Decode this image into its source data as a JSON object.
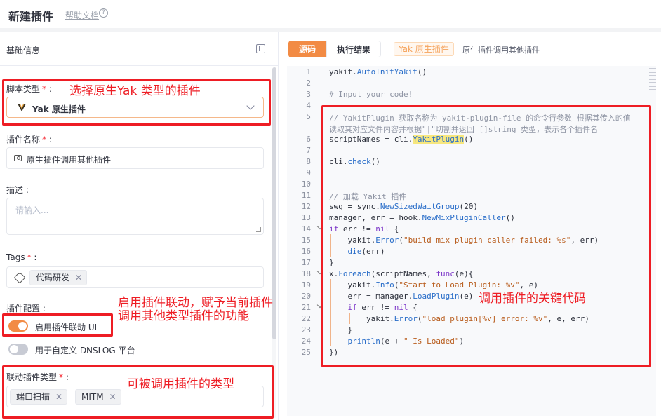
{
  "header": {
    "title": "新建插件",
    "help_link": "帮助文档",
    "help_icon": "question-circle-icon"
  },
  "left_panel": {
    "title": "基础信息",
    "script_type": {
      "label": "脚本类型",
      "required_mark": "*",
      "colon": ":",
      "value": "Yak 原生插件"
    },
    "plugin_name": {
      "label": "插件名称",
      "required_mark": "*",
      "colon": ":",
      "value": "原生插件调用其他插件"
    },
    "description": {
      "label": "描述",
      "colon": ":",
      "placeholder": "请输入..."
    },
    "tags": {
      "label": "Tags",
      "required_mark": "*",
      "colon": ":",
      "items": [
        "代码研发"
      ]
    },
    "plugin_config": {
      "label": "插件配置",
      "colon": ":",
      "switches": [
        {
          "label": "启用插件联动 UI",
          "on": true
        },
        {
          "label": "用于自定义 DNSLOG 平台",
          "on": false
        }
      ]
    },
    "linked_types": {
      "label": "联动插件类型",
      "required_mark": "*",
      "colon": ":",
      "items": [
        "端口扫描",
        "MITM"
      ]
    }
  },
  "right_panel": {
    "tabs": [
      {
        "label": "源码",
        "active": true
      },
      {
        "label": "执行结果",
        "active": false
      }
    ],
    "type_badge": "Yak 原生插件",
    "plugin_name": "原生插件调用其他插件"
  },
  "code_lines": [
    {
      "n": "1",
      "t": "yakit.AutoInitYakit()"
    },
    {
      "n": "2",
      "t": ""
    },
    {
      "n": "3",
      "t": "# Input your code!"
    },
    {
      "n": "4",
      "t": ""
    },
    {
      "n": "5",
      "t": "// YakitPlugin 获取名称为 yakit-plugin-file 的命令行参数 根据其传入的值"
    },
    {
      "n": "",
      "t": "读取其对应文件内容并根据\"|\"切割并返回 []string 类型，表示各个插件名"
    },
    {
      "n": "6",
      "t": "scriptNames = cli.YakitPlugin()"
    },
    {
      "n": "7",
      "t": ""
    },
    {
      "n": "8",
      "t": "cli.check()"
    },
    {
      "n": "9",
      "t": ""
    },
    {
      "n": "10",
      "t": ""
    },
    {
      "n": "11",
      "t": "// 加载 Yakit 插件"
    },
    {
      "n": "12",
      "t": "swg = sync.NewSizedWaitGroup(20)"
    },
    {
      "n": "13",
      "t": "manager, err = hook.NewMixPluginCaller()"
    },
    {
      "n": "14",
      "t": "if err != nil {"
    },
    {
      "n": "15",
      "t": "    yakit.Error(\"build mix plugin caller failed: %s\", err)"
    },
    {
      "n": "16",
      "t": "    die(err)"
    },
    {
      "n": "17",
      "t": "}"
    },
    {
      "n": "18",
      "t": "x.Foreach(scriptNames, func(e){"
    },
    {
      "n": "19",
      "t": "    yakit.Info(\"Start to Load Plugin: %v\", e)"
    },
    {
      "n": "20",
      "t": "    err = manager.LoadPlugin(e)"
    },
    {
      "n": "21",
      "t": "    if err != nil {"
    },
    {
      "n": "22",
      "t": "        yakit.Error(\"load plugin[%v] error: %v\", e, err)"
    },
    {
      "n": "23",
      "t": "    }"
    },
    {
      "n": "24",
      "t": "    println(e + \" Is Loaded\")"
    },
    {
      "n": "25",
      "t": "})"
    }
  ],
  "annotations": {
    "script_type": "选择原生Yak 类型的插件",
    "plugin_config": "启用插件联动，赋予当前插件调用其他类型插件的功能",
    "code": "调用插件的关键代码",
    "linked_types": "可被调用插件的类型"
  },
  "colors": {
    "accent": "#f28b44",
    "annotation": "#ee1d24"
  }
}
